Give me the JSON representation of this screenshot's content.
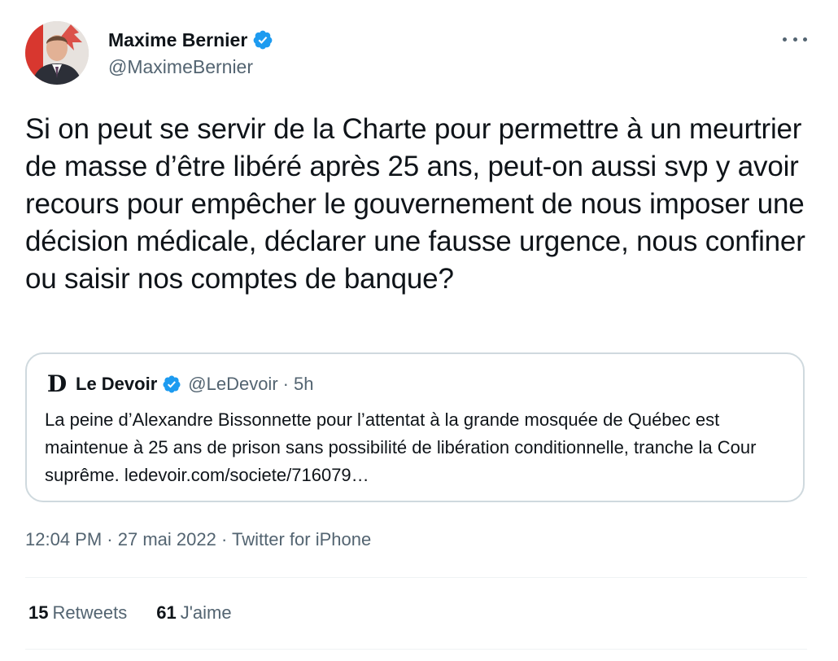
{
  "author": {
    "name": "Maxime Bernier",
    "handle": "@MaximeBernier",
    "verified": true
  },
  "tweet": {
    "text": "Si on peut se servir de la Charte pour permettre à un meurtrier de masse d’être libéré après 25 ans, peut-on aussi svp y avoir recours pour empêcher le gouvernement de nous imposer une décision médicale, déclarer une fausse urgence, nous confiner ou saisir nos comptes de banque?"
  },
  "quoted": {
    "logo": "D",
    "name": "Le Devoir",
    "handle": "@LeDevoir",
    "separator": "·",
    "time": "5h",
    "text": "La peine d’Alexandre Bissonnette pour l’attentat à la grande mosquée de Québec est maintenue à 25 ans de prison sans possibilité de libération conditionnelle, tranche la Cour suprême. ledevoir.com/societe/716079…"
  },
  "meta": {
    "time": "12:04 PM",
    "separator": "·",
    "date": "27 mai 2022",
    "source": "Twitter for iPhone"
  },
  "stats": {
    "retweets_count": "15",
    "retweets_label": "Retweets",
    "likes_count": "61",
    "likes_label": "J'aime"
  },
  "colors": {
    "verified": "#1d9bf0",
    "secondary_text": "#536471",
    "border": "#cfd9de"
  },
  "icons": {
    "verified": "verified-badge-icon",
    "more": "more-dots-icon"
  }
}
